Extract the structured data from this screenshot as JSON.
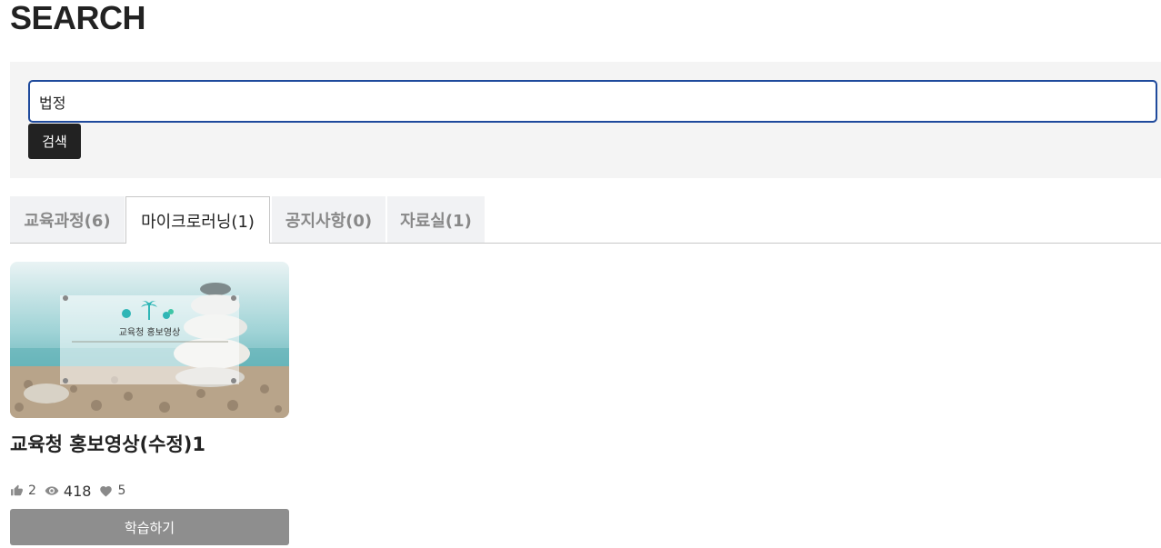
{
  "page": {
    "title": "SEARCH"
  },
  "search": {
    "value": "법정",
    "button_label": "검색"
  },
  "tabs": [
    {
      "label": "교육과정(6)",
      "active": false
    },
    {
      "label": "마이크로러닝(1)",
      "active": true
    },
    {
      "label": "공지사항(0)",
      "active": false
    },
    {
      "label": "자료실(1)",
      "active": false
    }
  ],
  "results": [
    {
      "thumbnail_caption": "교육청 홍보영상",
      "title": "교육청 홍보영상(수정)1",
      "likes": "2",
      "views": "418",
      "hearts": "5",
      "button_label": "학습하기"
    }
  ],
  "colors": {
    "input_border": "#1f4a9c",
    "search_button": "#222222",
    "panel_bg": "#f4f4f4",
    "learn_button": "#8e8e8e",
    "tab_inactive_bg": "#f1f2f4"
  }
}
